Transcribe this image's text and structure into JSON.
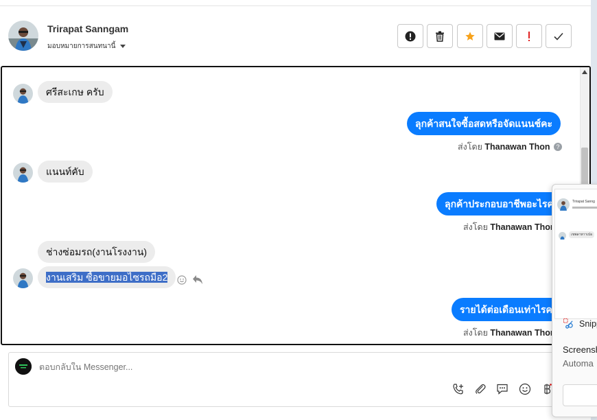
{
  "header": {
    "contact_name": "Trirapat Sanngam",
    "assign_label": "มอบหมายการสนทนานี้",
    "actions": [
      "alert-circle-icon",
      "trash-icon",
      "star-icon",
      "mail-icon",
      "important-icon",
      "check-icon"
    ],
    "colors": {
      "star": "#f7a21b",
      "important": "#e02020"
    }
  },
  "conversation": {
    "messages": [
      {
        "direction": "in",
        "text": "ศรีสะเกษ ครับ"
      },
      {
        "direction": "out",
        "text": "ลุกค้าสนใจซื้อสดหรือจัดแนนช์คะ",
        "sent_by_label": "ส่งโดย",
        "sender": "Thanawan Thon"
      },
      {
        "direction": "in",
        "text": "แนนท์คับ"
      },
      {
        "direction": "out",
        "text": "ลุกค้าประกอบอาชีพอะไรคะ",
        "sent_by_label": "ส่งโดย",
        "sender": "Thanawan Thon"
      },
      {
        "direction": "in",
        "text": "ช่างซ่อมรถ(งานโรงงาน)"
      },
      {
        "direction": "in",
        "text": "งานเสริม ซื้อขายมอไซรถมือ2"
      },
      {
        "direction": "out",
        "text": "รายได้ต่อเดือนเท่าไรคะ",
        "sent_by_label": "ส่งโดย",
        "sender": "Thanawan Thon"
      }
    ],
    "colors": {
      "outgoing": "#0a7cff",
      "incoming": "#ececec",
      "selection": "#3e6ec7"
    }
  },
  "reply": {
    "placeholder": "ตอบกลับใน Messenger...",
    "tools": [
      "phone-add-icon",
      "paperclip-icon",
      "quick-reply-icon",
      "emoji-icon",
      "baht-icon"
    ]
  },
  "snipping": {
    "thumb_name": "Trirapat Sanng",
    "thumb_msg": "เขพลาหาาเป่อ",
    "app_name": "Snipp",
    "title": "Screensh",
    "subtitle": "Automa"
  }
}
